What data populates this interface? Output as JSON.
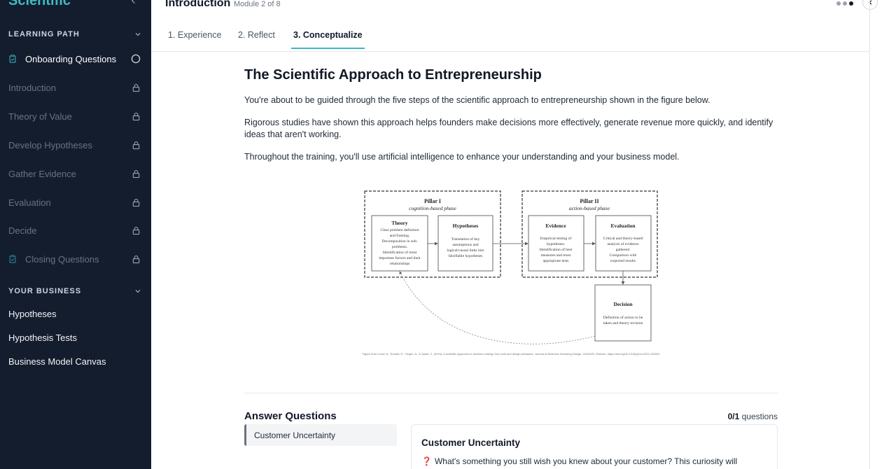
{
  "sidebar": {
    "brand": "Scientific",
    "learning_path": {
      "heading": "LEARNING PATH",
      "items": [
        {
          "label": "Onboarding Questions",
          "state": "active"
        },
        {
          "label": "Introduction",
          "state": "locked"
        },
        {
          "label": "Theory of Value",
          "state": "locked"
        },
        {
          "label": "Develop Hypotheses",
          "state": "locked"
        },
        {
          "label": "Gather Evidence",
          "state": "locked"
        },
        {
          "label": "Evaluation",
          "state": "locked"
        },
        {
          "label": "Decide",
          "state": "locked"
        },
        {
          "label": "Closing Questions",
          "state": "locked"
        }
      ]
    },
    "your_business": {
      "heading": "YOUR BUSINESS",
      "items": [
        "Hypotheses",
        "Hypothesis Tests",
        "Business Model Canvas"
      ]
    }
  },
  "header": {
    "title": "Introduction",
    "subtitle": "Module 2 of 8"
  },
  "tabs": [
    "1. Experience",
    "2. Reflect",
    "3. Conceptualize"
  ],
  "main": {
    "heading": "The Scientific Approach to Entrepreneurship",
    "p1": "You're about to be guided through the five steps of the scientific approach to entrepreneurship shown in the figure below.",
    "p2": "Rigorous studies have shown this approach helps founders make decisions more effectively, generate revenue more quickly, and identify ideas that aren't working.",
    "p3": "Throughout the training, you'll use artificial intelligence to enhance your understanding and your business model."
  },
  "figure": {
    "pillar1_title": "Pillar I",
    "pillar1_sub": "cognition-based phase",
    "pillar2_title": "Pillar II",
    "pillar2_sub": "action-based phase",
    "theory_title": "Theory",
    "theory_text": [
      "Clear problem definition",
      "and framing.",
      "Decomposition in sub-",
      "problems.",
      "Identification of most",
      "important factors and their",
      "relationships"
    ],
    "hyp_title": "Hypotheses",
    "hyp_text": [
      "Translation of key",
      "assumptions and",
      "logical/causal links into",
      "falsifiable hypotheses"
    ],
    "evid_title": "Evidence",
    "evid_text": [
      "Empirical testing of",
      "hypotheses.",
      "Identification of best",
      "measures and most",
      "appropriate tests"
    ],
    "eval_title": "Evaluation",
    "eval_text": [
      "Critical and theory-based",
      "analysis of evidence",
      "gathered.",
      "Comparison with",
      "expected results"
    ],
    "dec_title": "Decision",
    "dec_text": [
      "Definition of action to be",
      "taken and theory revision"
    ],
    "caption": "Figure from Cover, A., Ronald, E., Ozgen, A., & Spina, C. (2024). A scientific approach to decision making: Key tools and design principles. Journal of Business Venturing Design, 3/100020. Elsevier. https://doi.org/10.1016/j.jbvd.2024.100020"
  },
  "answer_questions": {
    "title": "Answer Questions",
    "count": "0/1",
    "count_suffix": "questions",
    "tab_label": "Customer Uncertainty",
    "card_title": "Customer Uncertainty",
    "card_icon": "❓",
    "card_text": "What's something you still wish you knew about your customer? This curiosity will"
  }
}
